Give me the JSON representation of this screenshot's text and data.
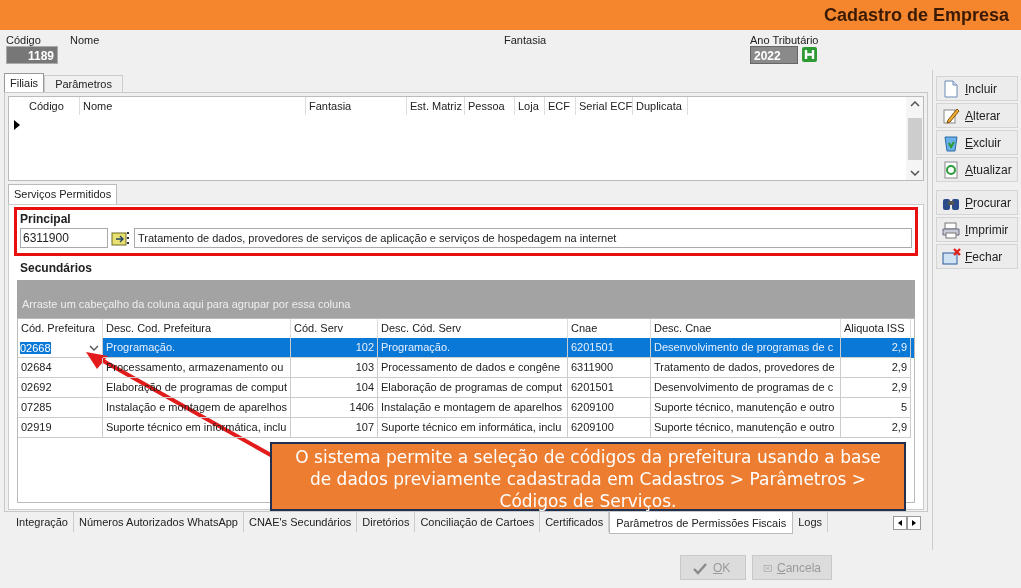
{
  "window": {
    "title": "Cadastro de Empresa"
  },
  "header": {
    "codigo": {
      "label": "Código",
      "value": "1189"
    },
    "nome": {
      "label": "Nome"
    },
    "fantasia": {
      "label": "Fantasia"
    },
    "ano": {
      "label": "Ano Tributário",
      "value": "2022"
    }
  },
  "tabs": [
    {
      "label": "Filiais",
      "selected": true
    },
    {
      "label": "Parâmetros",
      "selected": false
    }
  ],
  "filiais_grid": {
    "columns": [
      "Código",
      "Nome",
      "Fantasia",
      "Est. Matriz",
      "Pessoa",
      "Loja",
      "ECF",
      "Serial ECF",
      "Duplicata"
    ]
  },
  "service_tabs": [
    {
      "label": "Serviços Permitidos",
      "selected": true
    }
  ],
  "principal": {
    "heading": "Principal",
    "code": "6311900",
    "description": "Tratamento de dados, provedores de serviços de aplicação e serviços de hospedagem na internet"
  },
  "secundarios": {
    "heading": "Secundários",
    "group_hint": "Arraste um cabeçalho da coluna aqui para agrupar por essa coluna",
    "columns": [
      "Cód. Prefeitura",
      "Desc. Cod. Prefeitura",
      "Cód. Serv",
      "Desc. Cód. Serv",
      "Cnae",
      "Desc. Cnae",
      "Aliquota ISS"
    ],
    "rows": [
      {
        "selected": true,
        "cells": [
          "02668",
          "Programação.",
          "102",
          "Programação.",
          "6201501",
          "Desenvolvimento de programas de c",
          "2,9"
        ]
      },
      {
        "selected": false,
        "cells": [
          "02684",
          "Processamento, armazenamento ou",
          "103",
          "Processamento de dados e congêne",
          "6311900",
          "Tratamento de dados, provedores de",
          "2,9"
        ]
      },
      {
        "selected": false,
        "cells": [
          "02692",
          "Elaboração de programas de comput",
          "104",
          "Elaboração de programas de comput",
          "6201501",
          "Desenvolvimento de programas de c",
          "2,9"
        ]
      },
      {
        "selected": false,
        "cells": [
          "07285",
          "Instalação e montagem de aparelhos",
          "1406",
          "Instalação e montagem de aparelhos",
          "6209100",
          "Suporte técnico, manutenção e outro",
          "5"
        ]
      },
      {
        "selected": false,
        "cells": [
          "02919",
          "Suporte técnico em informática, inclu",
          "107",
          "Suporte técnico em informática, inclu",
          "6209100",
          "Suporte técnico, manutenção e outro",
          "2,9"
        ]
      }
    ]
  },
  "callout": "O sistema permite a seleção de códigos da prefeitura usando a base de dados previamente cadastrada em Cadastros > Parâmetros > Códigos de Serviços.",
  "bottom_tabs": [
    {
      "label": "Integração",
      "selected": false
    },
    {
      "label": "Números Autorizados WhatsApp",
      "selected": false
    },
    {
      "label": "CNAE's Secundários",
      "selected": false
    },
    {
      "label": "Diretórios",
      "selected": false
    },
    {
      "label": "Conciliação de Cartoes",
      "selected": false
    },
    {
      "label": "Certificados",
      "selected": false
    },
    {
      "label": "Parâmetros de Permissões Fiscais",
      "selected": true
    },
    {
      "label": "Logs",
      "selected": false
    }
  ],
  "side_buttons": [
    {
      "label": "Incluir",
      "disabled": false
    },
    {
      "label": "Alterar",
      "disabled": false
    },
    {
      "label": "Excluir",
      "disabled": false
    },
    {
      "label": "Atualizar",
      "disabled": false
    },
    {
      "label": "Procurar",
      "disabled": false
    },
    {
      "label": "Imprimir",
      "disabled": false
    },
    {
      "label": "Fechar",
      "disabled": false
    }
  ],
  "footer_buttons": [
    {
      "label": "OK",
      "disabled": true
    },
    {
      "label": "Cancela",
      "disabled": true
    }
  ]
}
